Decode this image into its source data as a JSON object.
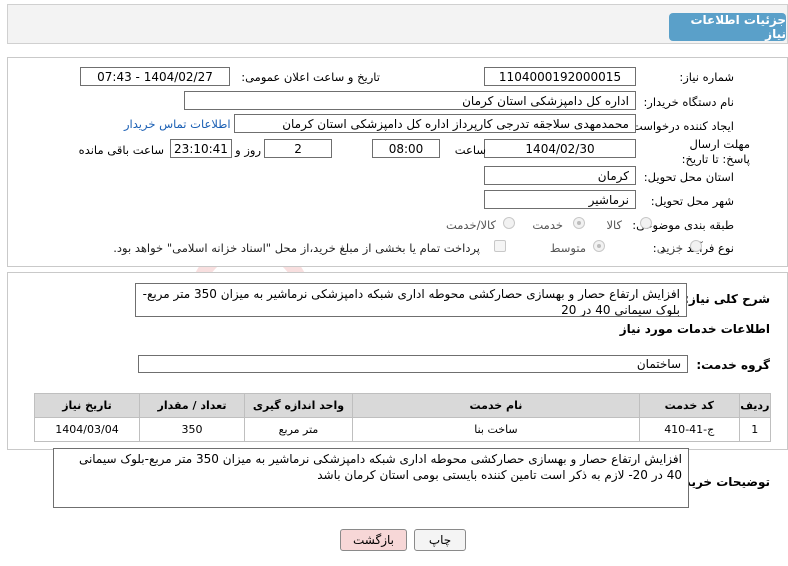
{
  "header": {
    "title": "جزئیات اطلاعات نیاز"
  },
  "fields": {
    "need_number_label": "شماره نیاز:",
    "need_number": "1104000192000015",
    "announce_label": "تاریخ و ساعت اعلان عمومی:",
    "announce_value": "1404/02/27 - 07:43",
    "buyer_org_label": "نام دستگاه خریدار:",
    "buyer_org": "اداره کل دامپزشکی استان کرمان",
    "creator_label": "ایجاد کننده درخواست:",
    "creator": "محمدمهدی سلاجقه تدرجی کارپرداز اداره کل دامپزشکی استان کرمان",
    "contact_link": "اطلاعات تماس خریدار",
    "deadline_label": "مهلت ارسال پاسخ: تا تاریخ:",
    "deadline_date": "1404/02/30",
    "hour_label": "ساعت",
    "deadline_hour": "08:00",
    "days_value": "2",
    "days_label": "روز و",
    "remaining_time": "23:10:41",
    "remaining_label": "ساعت باقی مانده",
    "province_label": "استان محل تحویل:",
    "province": "کرمان",
    "city_label": "شهر محل تحویل:",
    "city": "نرماشیر",
    "category_label": "طبقه بندی موضوعی:",
    "category_options": [
      "کالا",
      "خدمت",
      "کالا/خدمت"
    ],
    "process_label": "نوع فرآیند خرید :",
    "process_options": [
      "جزیی",
      "متوسط"
    ],
    "payment_note": "پرداخت تمام یا بخشی از مبلغ خرید،از محل \"اسناد خزانه اسلامی\" خواهد بود."
  },
  "description": {
    "label": "شرح کلی نیاز:",
    "text": "افزایش ارتفاع حصار و بهسازی حصارکشی محوطه اداری شبکه دامپزشکی نرماشیر به میزان 350 متر مربع-بلوک سیمانی 40 در 20"
  },
  "services": {
    "title": "اطلاعات خدمات مورد نیاز",
    "group_label": "گروه خدمت:",
    "group_value": "ساختمان",
    "columns": [
      "ردیف",
      "کد خدمت",
      "نام خدمت",
      "واحد اندازه گیری",
      "تعداد / مقدار",
      "تاریخ نیاز"
    ],
    "rows": [
      [
        "1",
        "ج-41-410",
        "ساخت بنا",
        "متر مربع",
        "350",
        "1404/03/04"
      ]
    ]
  },
  "buyer_notes": {
    "label": "توضیحات خریدار:",
    "text": "افزایش ارتفاع حصار و بهسازی حصارکشی محوطه اداری شبکه دامپزشکی نرماشیر به میزان 350 متر مربع-بلوک سیمانی 40 در 20- لازم به ذکر است تامین کننده بایستی بومی استان کرمان باشد"
  },
  "buttons": {
    "print": "چاپ",
    "back": "بازگشت"
  },
  "watermark": {
    "text": "AriaTender.net"
  },
  "colors": {
    "header_button": "#5aa0c9",
    "link": "#1a5fb4",
    "back_button": "#f7d7d7"
  }
}
